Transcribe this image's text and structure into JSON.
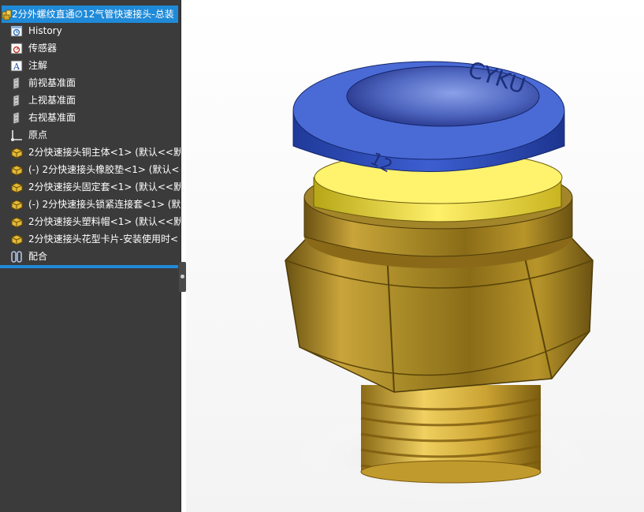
{
  "feature_tree": {
    "root": {
      "label": "2分外螺纹直通∅12气管快速接头-总装",
      "icon": "assembly-icon"
    },
    "items": [
      {
        "label": "History",
        "icon": "history-icon"
      },
      {
        "label": "传感器",
        "icon": "sensor-icon"
      },
      {
        "label": "注解",
        "icon": "annotation-icon"
      },
      {
        "label": "前视基准面",
        "icon": "plane-icon"
      },
      {
        "label": "上视基准面",
        "icon": "plane-icon"
      },
      {
        "label": "右视基准面",
        "icon": "plane-icon"
      },
      {
        "label": "原点",
        "icon": "origin-icon"
      },
      {
        "label": "2分快速接头铜主体<1> (默认<<默",
        "icon": "part-icon"
      },
      {
        "label": "(-) 2分快速接头橡胶垫<1> (默认<<",
        "icon": "part-icon"
      },
      {
        "label": "2分快速接头固定套<1> (默认<<默",
        "icon": "part-icon"
      },
      {
        "label": "(-) 2分快速接头锁紧连接套<1> (默",
        "icon": "part-icon"
      },
      {
        "label": "2分快速接头塑料帽<1> (默认<<默",
        "icon": "part-icon"
      },
      {
        "label": "2分快速接头花型卡片-安装使用时<",
        "icon": "part-icon"
      },
      {
        "label": "配合",
        "icon": "mates-icon"
      }
    ]
  },
  "model": {
    "cap_text": "CYKU",
    "size_text": "12",
    "colors": {
      "cap": "#3350b8",
      "brass": "#b8952a",
      "thread": "#d9b84a",
      "yellow_ring": "#f2e23a"
    }
  },
  "colors": {
    "panel_bg": "#3b3b3b",
    "selection": "#1f8ad8",
    "viewport_bg": "#ffffff"
  }
}
